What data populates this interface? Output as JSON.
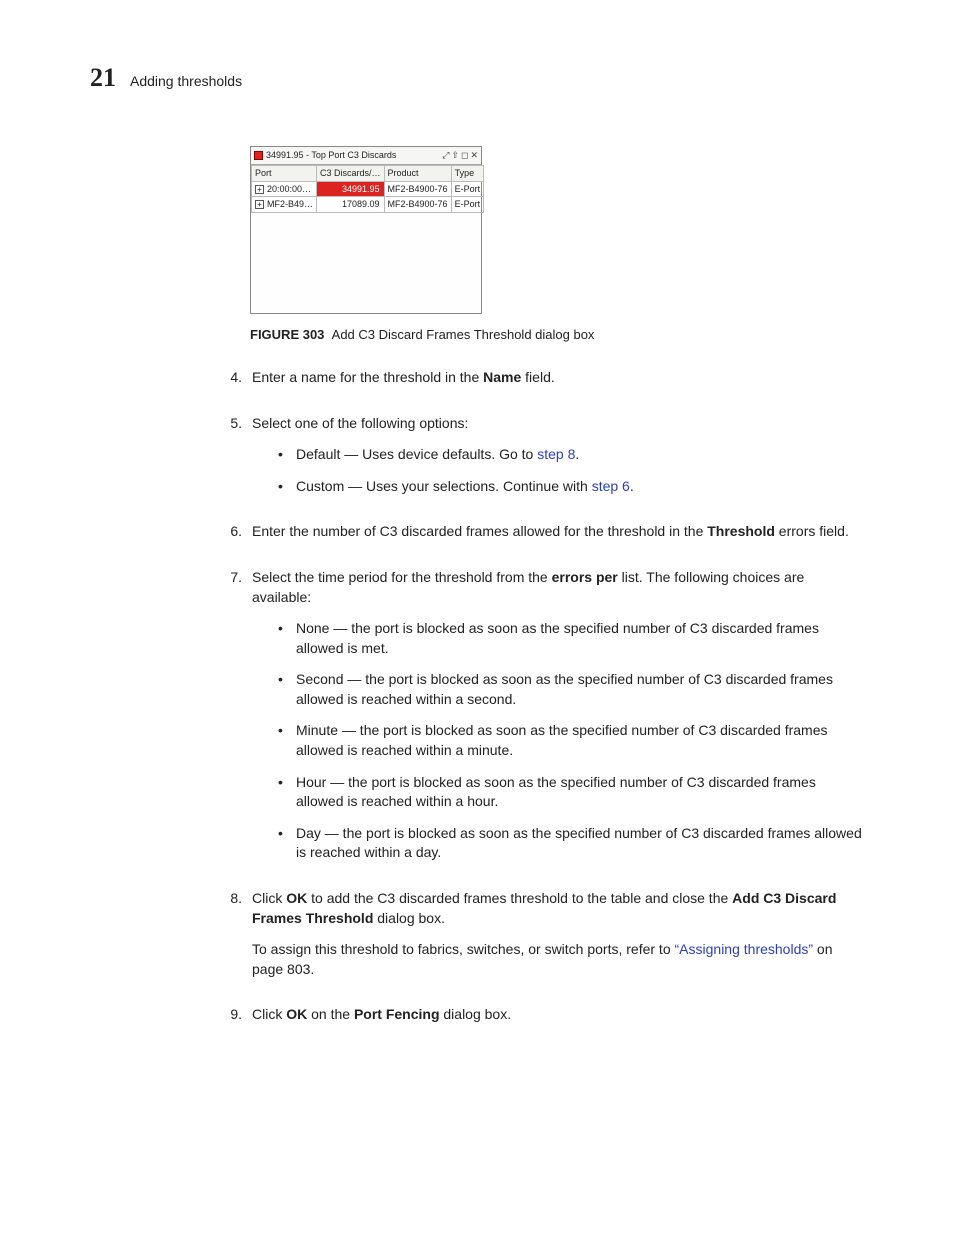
{
  "header": {
    "chapter_number": "21",
    "chapter_title": "Adding thresholds"
  },
  "figure": {
    "titlebar": "34991.95 - Top Port C3 Discards",
    "columns": [
      "Port",
      "C3 Discards/…",
      "Product",
      "Type"
    ],
    "rows": [
      {
        "port": "20:00:00…",
        "c3": "34991.95",
        "product": "MF2-B4900-76",
        "type": "E-Port",
        "hl": true
      },
      {
        "port": "MF2-B49…",
        "c3": "17089.09",
        "product": "MF2-B4900-76",
        "type": "E-Port",
        "hl": false
      }
    ],
    "caption_label": "FIGURE 303",
    "caption_text": "Add C3 Discard Frames Threshold dialog box"
  },
  "steps": {
    "s4": {
      "n": "4.",
      "text_a": "Enter a name for the threshold in the ",
      "bold": "Name",
      "text_b": " field."
    },
    "s5": {
      "n": "5.",
      "intro": "Select one of the following options:",
      "opt1_a": "Default — Uses device defaults. Go to ",
      "opt1_link": "step 8",
      "opt1_b": ".",
      "opt2_a": "Custom — Uses your selections. Continue with ",
      "opt2_link": "step 6",
      "opt2_b": "."
    },
    "s6": {
      "n": "6.",
      "text_a": "Enter the number of C3 discarded frames allowed for the threshold in the ",
      "bold": "Threshold",
      "text_b": " errors field."
    },
    "s7": {
      "n": "7.",
      "intro_a": "Select the time period for the threshold from the ",
      "intro_bold": "errors per",
      "intro_b": " list. The following choices are available:",
      "items": [
        "None — the port is blocked as soon as the specified number of C3 discarded frames allowed is met.",
        "Second — the port is blocked as soon as the specified number of C3 discarded frames allowed is reached within a second.",
        "Minute — the port is blocked as soon as the specified number of C3 discarded frames allowed is reached within a minute.",
        "Hour — the port is blocked as soon as the specified number of C3 discarded frames allowed is reached within a hour.",
        "Day — the port is blocked as soon as the specified number of C3 discarded frames allowed is reached within a day."
      ]
    },
    "s8": {
      "n": "8.",
      "p1_a": "Click ",
      "p1_b1": "OK",
      "p1_b": " to add the C3 discarded frames threshold to the table and close the ",
      "p1_b2": "Add C3 Discard Frames Threshold",
      "p1_c": " dialog box.",
      "p2_a": "To assign this threshold to fabrics, switches, or switch ports, refer to ",
      "p2_link": "“Assigning thresholds”",
      "p2_b": " on page 803."
    },
    "s9": {
      "n": "9.",
      "a": "Click ",
      "b1": "OK",
      "b": " on the ",
      "b2": "Port Fencing",
      "c": " dialog box."
    }
  }
}
